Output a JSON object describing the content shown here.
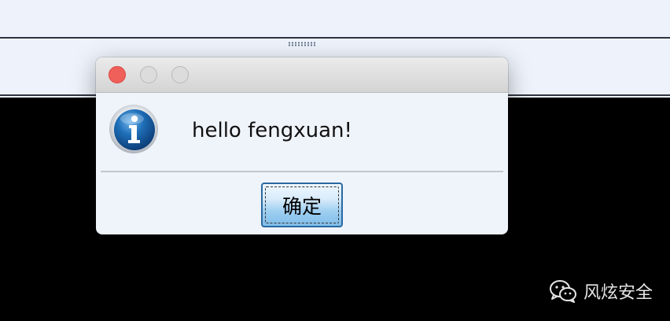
{
  "dialog": {
    "message": "hello fengxuan!",
    "ok_label": "确定",
    "icon": "info-icon"
  },
  "titlebar": {
    "buttons": [
      "close",
      "minimize",
      "maximize"
    ]
  },
  "watermark": {
    "text": "风炫安全",
    "icon": "wechat-logo-icon"
  },
  "colors": {
    "close_button": "#f0605a",
    "dialog_bg": "#eff3fa",
    "button_accent": "#7fbde9"
  }
}
